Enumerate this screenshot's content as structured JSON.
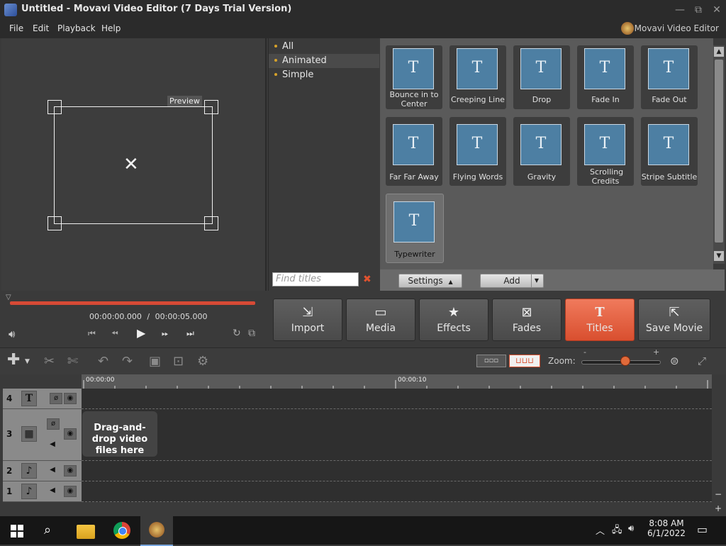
{
  "window": {
    "title": "Untitled - Movavi Video Editor (7 Days Trial Version)",
    "minimize": "—",
    "restore": "⧉",
    "close": "✕"
  },
  "menu": {
    "items": [
      "File",
      "Edit",
      "Playback",
      "Help"
    ],
    "brand": "Movavi Video Editor"
  },
  "preview": {
    "label": "Preview"
  },
  "categories": [
    {
      "label": "All",
      "selected": false
    },
    {
      "label": "Animated",
      "selected": true
    },
    {
      "label": "Simple",
      "selected": false
    }
  ],
  "search": {
    "placeholder": "Find titles",
    "clear_icon": "✖"
  },
  "titles": [
    {
      "label": "Bounce in to Center",
      "glyph": "T"
    },
    {
      "label": "Creeping Line",
      "glyph": "T"
    },
    {
      "label": "Drop",
      "glyph": "T"
    },
    {
      "label": "Fade In",
      "glyph": "T"
    },
    {
      "label": "Fade Out",
      "glyph": "T"
    },
    {
      "label": "Far Far Away",
      "glyph": "T"
    },
    {
      "label": "Flying Words",
      "glyph": "T"
    },
    {
      "label": "Gravity",
      "glyph": "T"
    },
    {
      "label": "Scrolling Credits",
      "glyph": "T"
    },
    {
      "label": "Stripe Subtitle",
      "glyph": "T"
    },
    {
      "label": "Typewriter",
      "glyph": "T",
      "selected": true
    }
  ],
  "title_actions": {
    "settings": "Settings",
    "settings_arrow": "▲",
    "add": "Add",
    "add_arrow": "▼"
  },
  "playback": {
    "current_time": "00:00:00.000",
    "separator": "/",
    "total_time": "00:00:05.000",
    "progress": 1.0
  },
  "tool_buttons": [
    {
      "label": "Import",
      "icon": "import-icon",
      "active": false
    },
    {
      "label": "Media",
      "icon": "media-icon",
      "active": false
    },
    {
      "label": "Effects",
      "icon": "star-icon",
      "active": false
    },
    {
      "label": "Fades",
      "icon": "fades-icon",
      "active": false
    },
    {
      "label": "Titles",
      "icon": "titles-icon",
      "active": true
    },
    {
      "label": "Save Movie",
      "icon": "save-icon",
      "active": false
    }
  ],
  "timeline": {
    "zoom_label": "Zoom:",
    "zoom_minus": "-",
    "zoom_plus": "+",
    "zoom_level": 0.55,
    "ruler_labels": [
      "00:00:00",
      "00:00:10"
    ],
    "tracks": [
      {
        "num": "4",
        "type": "title"
      },
      {
        "num": "3",
        "type": "video"
      },
      {
        "num": "2",
        "type": "audio"
      },
      {
        "num": "1",
        "type": "audio"
      }
    ],
    "dropzone_text": "Drag-and-drop video files here"
  },
  "taskbar": {
    "time": "8:08 AM",
    "date": "6/1/2022"
  },
  "colors": {
    "accent": "#d94f2f",
    "title_thumb": "#4d7fa3"
  }
}
